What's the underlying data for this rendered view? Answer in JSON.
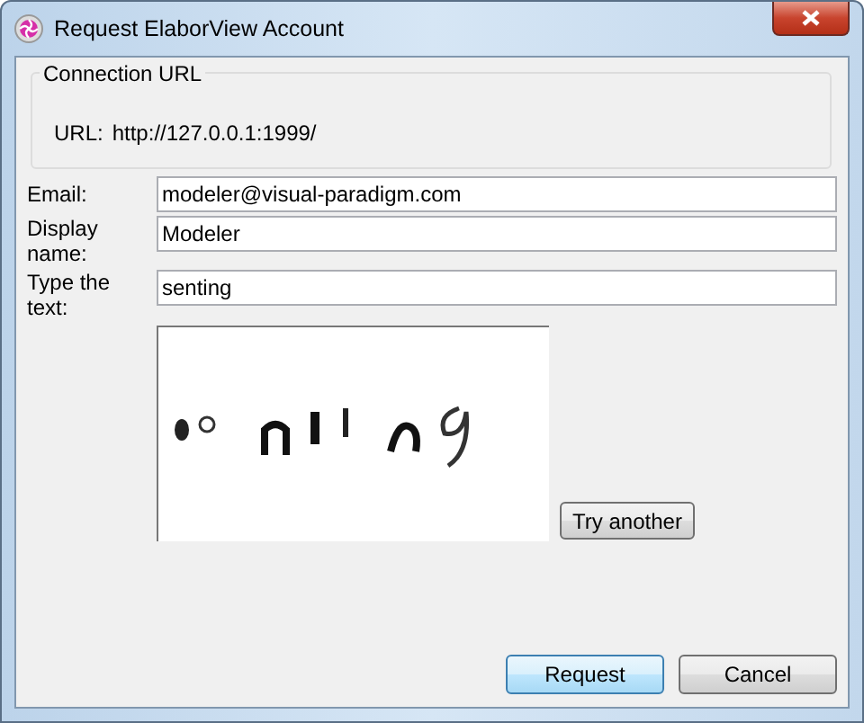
{
  "window": {
    "title": "Request ElaborView Account"
  },
  "connection": {
    "legend": "Connection URL",
    "label": "URL:",
    "value": "http://127.0.0.1:1999/"
  },
  "fields": [
    {
      "label": "Email:",
      "value": "modeler@visual-paradigm.com"
    },
    {
      "label": "Display name:",
      "value": "Modeler"
    },
    {
      "label": "Type the text:",
      "value": "senting"
    }
  ],
  "captcha": {
    "kind": "picture",
    "button": "Try another"
  },
  "buttons": [
    {
      "label": "Request",
      "default": true
    },
    {
      "label": "Cancel",
      "default": false
    }
  ]
}
